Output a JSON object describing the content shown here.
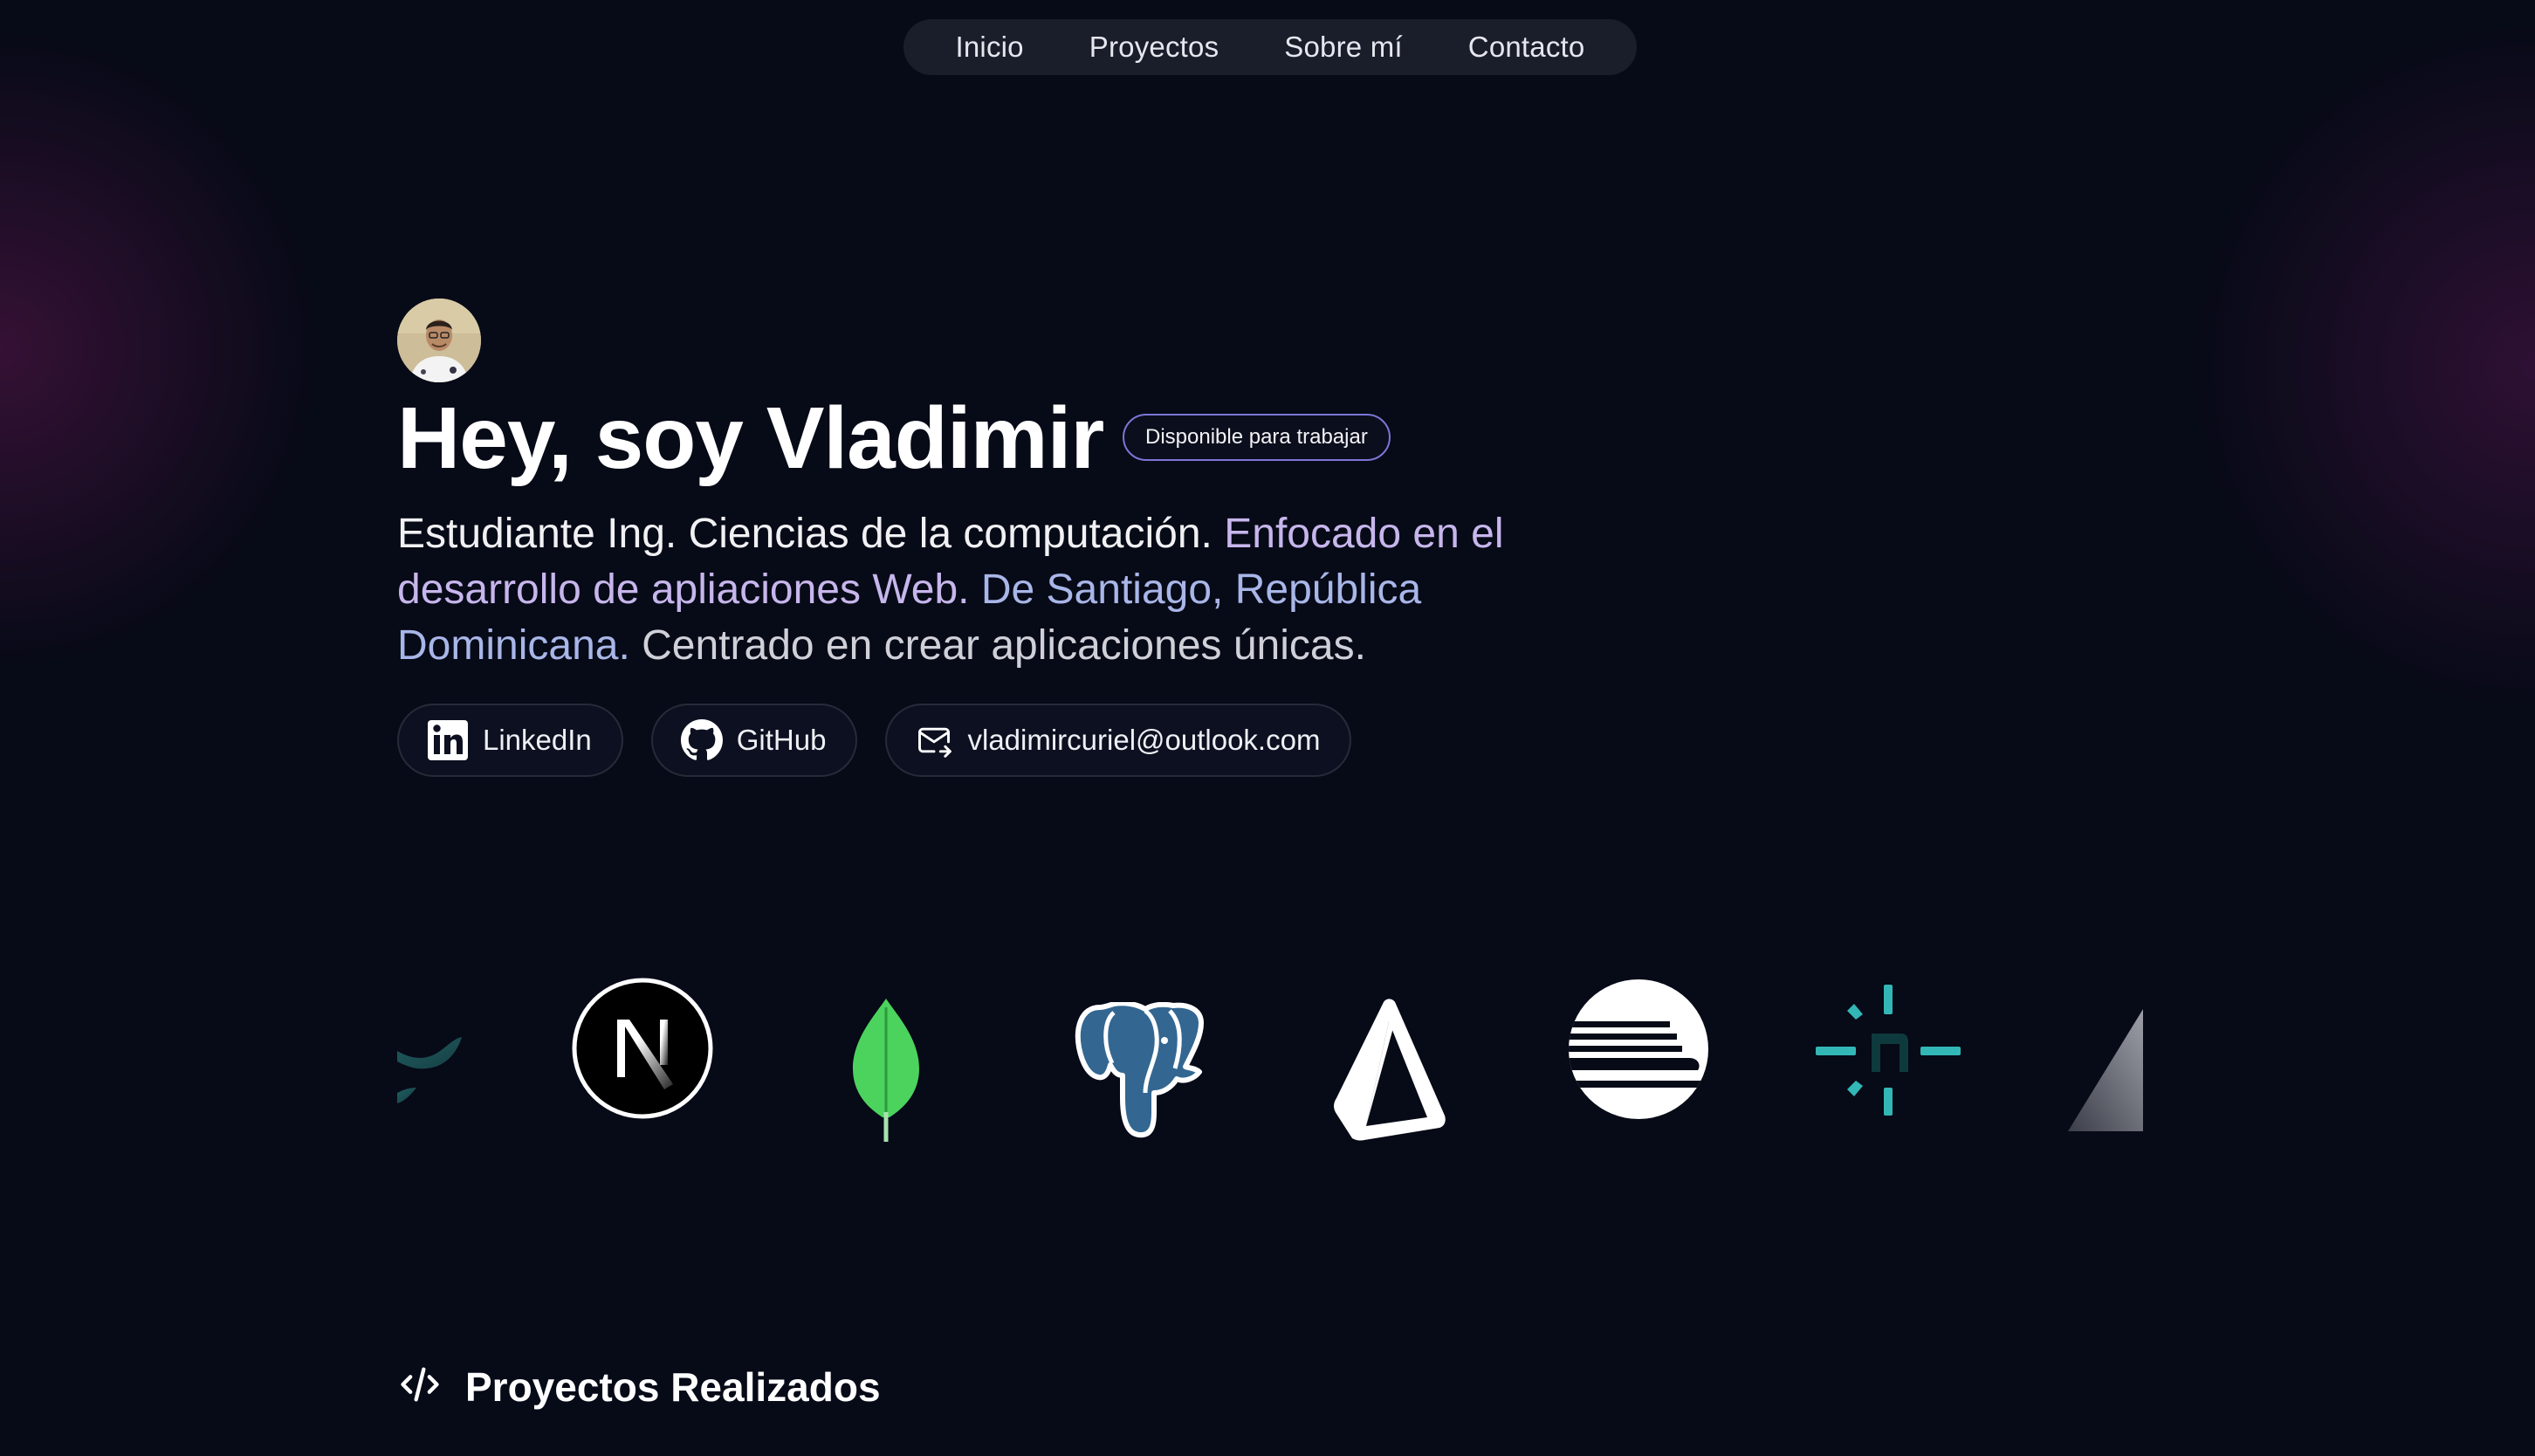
{
  "nav": {
    "items": [
      "Inicio",
      "Proyectos",
      "Sobre mí",
      "Contacto"
    ]
  },
  "hero": {
    "title": "Hey, soy Vladimir",
    "badge": "Disponible para trabajar",
    "description": {
      "part1": "Estudiante Ing. Ciencias de la computación. ",
      "part2": "Enfocado en el desarrollo de apliaciones Web. ",
      "part3": "De Santiago, República Dominicana. ",
      "part4": "Centrado en crear aplicaciones únicas."
    }
  },
  "links": {
    "linkedin": "LinkedIn",
    "github": "GitHub",
    "email": "vladimircuriel@outlook.com"
  },
  "tech_logos": [
    "tailwind-icon",
    "nextjs-icon",
    "mongodb-icon",
    "postgresql-icon",
    "prisma-icon",
    "astro-icon",
    "netlify-icon",
    "vercel-icon"
  ],
  "section": {
    "title": "Proyectos Realizados"
  },
  "colors": {
    "background": "#070a17",
    "accent_purple": "#c7b6ec",
    "accent_blue": "#a8b6e8",
    "badge_border": "#7b76d6"
  }
}
